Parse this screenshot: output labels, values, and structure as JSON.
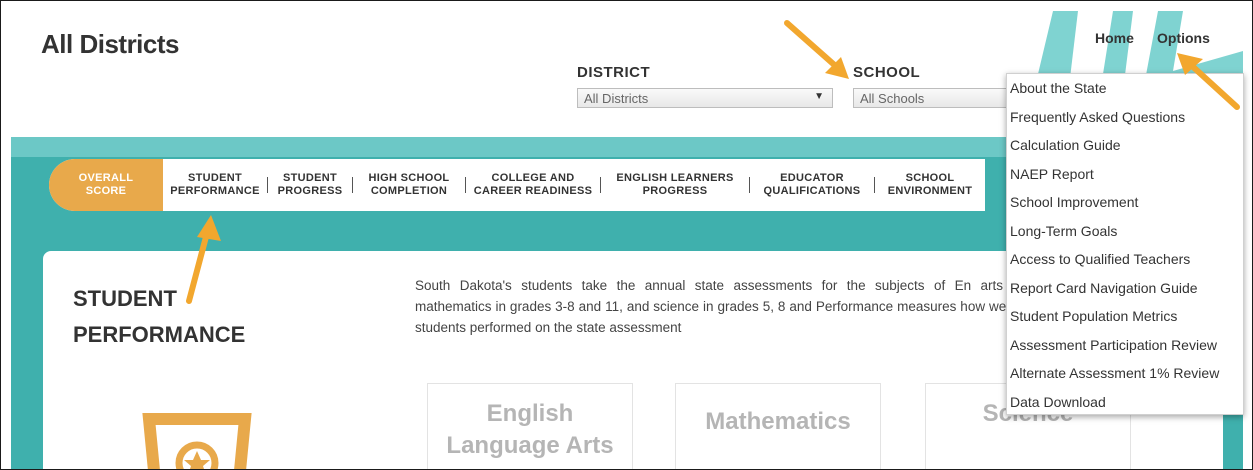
{
  "header": {
    "title": "All Districts",
    "district_label": "DISTRICT",
    "district_value": "All Districts",
    "school_label": "SCHOOL",
    "school_value": "All Schools",
    "home_link": "Home",
    "options_link": "Options"
  },
  "tabs": [
    {
      "label": "OVERALL\nSCORE",
      "active": true
    },
    {
      "label": "STUDENT\nPERFORMANCE",
      "active": false
    },
    {
      "label": "STUDENT\nPROGRESS",
      "active": false
    },
    {
      "label": "HIGH SCHOOL\nCOMPLETION",
      "active": false
    },
    {
      "label": "COLLEGE AND\nCAREER READINESS",
      "active": false
    },
    {
      "label": "ENGLISH LEARNERS\nPROGRESS",
      "active": false
    },
    {
      "label": "EDUCATOR\nQUALIFICATIONS",
      "active": false
    },
    {
      "label": "SCHOOL\nENVIRONMENT",
      "active": false
    }
  ],
  "section": {
    "title": "STUDENT\nPERFORMANCE",
    "description": "South Dakota's students take the annual state assessments for the subjects of En arts and mathematics in grades 3-8 and 11, and science in grades 5, 8 and Performance measures how well the students performed on the state assessment",
    "subjects": [
      "English\nLanguage Arts",
      "Mathematics",
      "Science"
    ]
  },
  "options_menu": [
    "About the State",
    "Frequently Asked Questions",
    "Calculation Guide",
    "NAEP Report",
    "School Improvement",
    "Long-Term Goals",
    "Access to Qualified Teachers",
    "Report Card Navigation Guide",
    "Student Population Metrics",
    "Assessment Participation Review",
    "Alternate Assessment 1% Review",
    "Data Download"
  ],
  "colors": {
    "accent_orange": "#e8a94b",
    "teal": "#3fb0ad",
    "arrow": "#f2a72e"
  },
  "icons": {
    "trophy": "trophy-icon",
    "caret": "chevron-down-icon"
  }
}
